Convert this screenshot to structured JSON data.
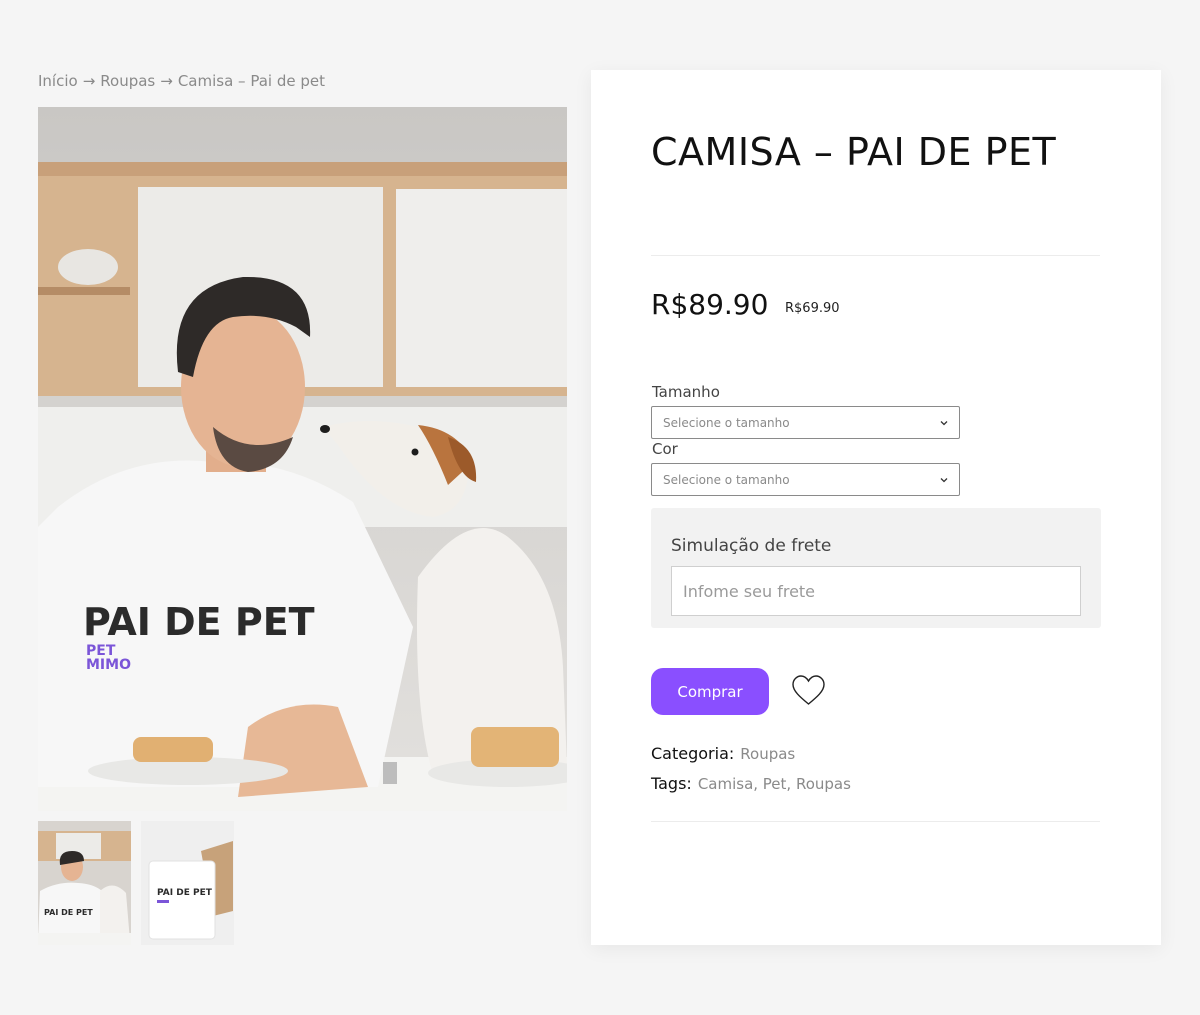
{
  "breadcrumb": {
    "items": [
      "Início",
      "Roupas",
      "Camisa – Pai de pet"
    ],
    "separator": "→"
  },
  "gallery": {
    "main_image_alt": "Homem com camisa Pai de Pet beijando um cachorro",
    "shirt_text": "PAI DE PET",
    "brand_text_line1": "PET",
    "brand_text_line2": "MIMO",
    "thumbnails": [
      "thumb-man-dog",
      "thumb-folded-shirt"
    ]
  },
  "product": {
    "title": "CAMISA – PAI DE PET",
    "price": "R$89.90",
    "old_price": "R$69.90",
    "size_label": "Tamanho",
    "size_placeholder": "Selecione o tamanho",
    "color_label": "Cor",
    "color_placeholder": "Selecione o tamanho",
    "shipping_title": "Simulação de frete",
    "shipping_placeholder": "Infome seu frete",
    "buy_label": "Comprar",
    "category_label": "Categoria:",
    "category_value": "Roupas",
    "tags_label": "Tags:",
    "tags_value": "Camisa, Pet, Roupas"
  },
  "colors": {
    "accent": "#8a4fff",
    "background": "#f5f5f5",
    "panel": "#ffffff",
    "muted_text": "#8a8a8a"
  },
  "icons": [
    "chevron-down-icon",
    "heart-icon"
  ]
}
